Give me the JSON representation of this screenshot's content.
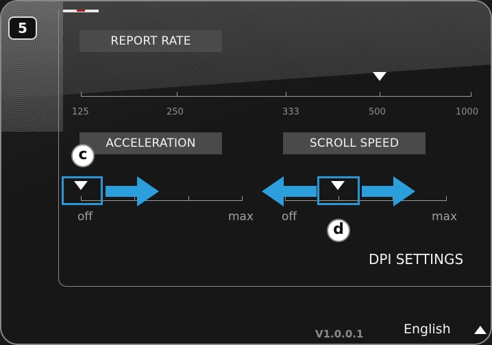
{
  "step_badge": "5",
  "report_rate": {
    "label": "REPORT RATE",
    "ticks": [
      "125",
      "250",
      "333",
      "500",
      "1000"
    ],
    "selected": "500"
  },
  "acceleration": {
    "label": "ACCELERATION",
    "min_label": "off",
    "max_label": "max",
    "badge": "c"
  },
  "scroll_speed": {
    "label": "SCROLL SPEED",
    "min_label": "off",
    "max_label": "max",
    "badge": "d"
  },
  "dpi_settings_label": "DPI SETTINGS",
  "version": "V1.0.0.1",
  "language": "English",
  "colors": {
    "highlight": "#2a97d6",
    "arrow": "#2a9fdc"
  }
}
